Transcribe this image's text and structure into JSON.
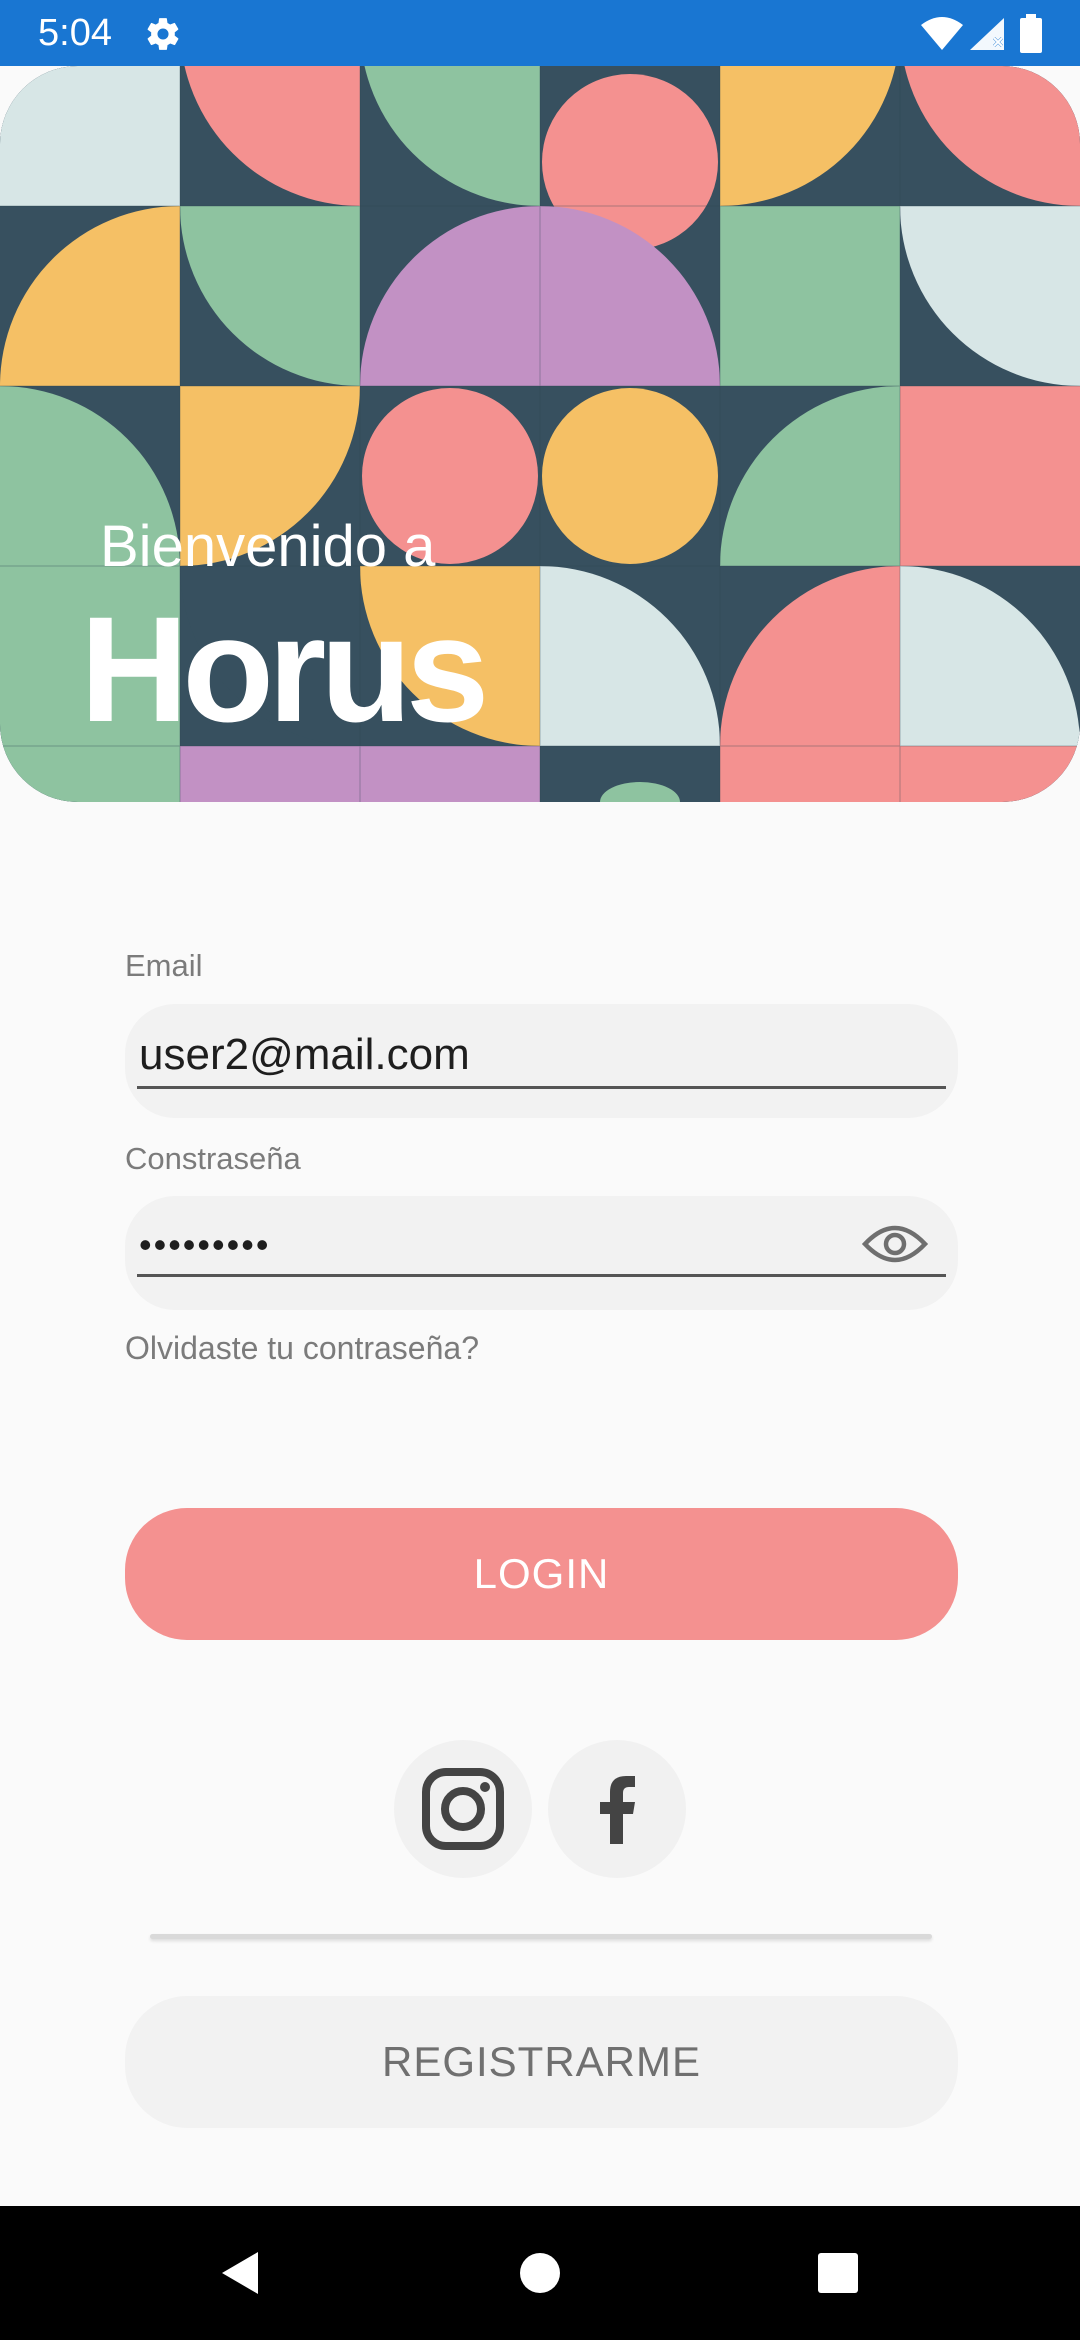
{
  "status_bar": {
    "time": "5:04",
    "icons": [
      "gear-icon",
      "wifi-icon",
      "cell-signal-icon",
      "battery-icon"
    ],
    "color": "#1976d2"
  },
  "hero": {
    "welcome": "Bienvenido a",
    "brand": "Horus",
    "pattern_colors": {
      "navy": "#37505f",
      "coral": "#f49190",
      "mustard": "#f5c065",
      "sage": "#8ec3a0",
      "lavender": "#c291c4",
      "mist": "#d7e6e6"
    }
  },
  "form": {
    "email_label": "Email",
    "email_value": "user2@mail.com",
    "password_label": "Constraseña",
    "password_value": "•••••••••",
    "forgot_password": "Olvidaste tu contraseña?"
  },
  "actions": {
    "login": "LOGIN",
    "register": "REGISTRARME",
    "login_color": "#f49190"
  },
  "social": [
    "instagram-icon",
    "facebook-icon"
  ],
  "nav_bar": [
    "back-icon",
    "home-icon",
    "recents-icon"
  ]
}
